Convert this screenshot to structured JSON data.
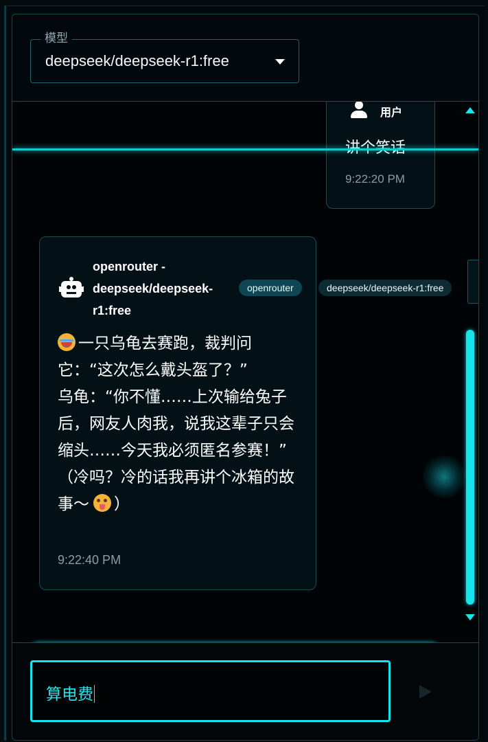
{
  "header": {
    "model_label": "模型",
    "model_value": "deepseek/deepseek-r1:free"
  },
  "messages": [
    {
      "role": "user",
      "sender": "用户",
      "text": "讲个笑话",
      "time": "9:22:20 PM"
    },
    {
      "role": "assistant",
      "sender": "openrouter - deepseek/deepseek-r1:free",
      "provider_tag": "openrouter",
      "model_tag": "deepseek/deepseek-r1:free",
      "lines": [
        "一只乌龟去赛跑，裁判问它：“这次怎么戴头盔了？”",
        "乌龟：“你不懂……上次输给兔子后，网友人肉我，说我这辈子只会缩头……今天我必须匿名参赛！”",
        "（冷吗？冷的话我再讲个冰箱的故事～",
        "）"
      ],
      "time": "9:22:40 PM"
    }
  ],
  "composer": {
    "input_value": "算电费"
  },
  "icons": {
    "user": "user-icon",
    "bot": "robot-icon",
    "send": "send-icon",
    "dropdown": "chevron-down-icon",
    "emoji_1": "laughing-tears-emoji",
    "emoji_2": "winking-tongue-emoji"
  },
  "colors": {
    "accent": "#19e3ea",
    "border": "#1a4c57",
    "bubble_bg": "#031116",
    "provider_chip": "#0f4653",
    "model_chip": "#0d2b33"
  }
}
